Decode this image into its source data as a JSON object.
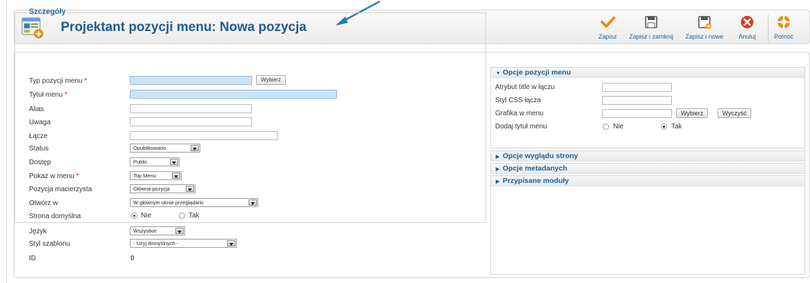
{
  "header": {
    "title": "Projektant pozycji menu: Nowa pozycja",
    "icon": "menu-item-add-icon"
  },
  "toolbar": {
    "buttons": [
      {
        "label": "Zapisz",
        "icon": "checkmark-icon",
        "color": "#f08c00"
      },
      {
        "label": "Zapisz i zamknij",
        "icon": "save-close-icon",
        "color": "#555555"
      },
      {
        "label": "Zapisz i nowe",
        "icon": "save-new-icon",
        "color": "#555555"
      },
      {
        "label": "Anuluj",
        "icon": "cancel-icon",
        "color": "#d63b1f"
      },
      {
        "label": "Pomoc",
        "icon": "help-icon",
        "color": "#f08c00"
      }
    ]
  },
  "details": {
    "legend": "Szczegóły",
    "type": {
      "label": "Typ pozycji menu",
      "button": "Wybierz"
    },
    "title": {
      "label": "Tytuł menu"
    },
    "alias": {
      "label": "Alias"
    },
    "note": {
      "label": "Uwaga"
    },
    "link": {
      "label": "Łącze"
    },
    "status": {
      "label": "Status",
      "value": "Opublikowano"
    },
    "access": {
      "label": "Dostęp",
      "value": "Public"
    },
    "menu": {
      "label": "Pokaż w menu",
      "value": "Top Menu"
    },
    "parent": {
      "label": "Pozycja macierzysta",
      "value": "Główna pozycja"
    },
    "target": {
      "label": "Otwórz w",
      "value": "W głównym oknie przeglądarki"
    },
    "default_page": {
      "label": "Strona domyślna",
      "option_no": "Nie",
      "option_yes": "Tak",
      "selected": "Nie"
    },
    "language": {
      "label": "Język",
      "value": "Wszystkie"
    },
    "template_style": {
      "label": "Styl szablonu",
      "value": "- Użyj domyślnych -"
    },
    "id": {
      "label": "ID",
      "value": "0"
    }
  },
  "link_options": {
    "header": "Opcje pozycji menu",
    "title_attr": {
      "label": "Atrybut title w łączu"
    },
    "css_style": {
      "label": "Styl CSS łącza"
    },
    "image": {
      "label": "Grafika w menu",
      "select_button": "Wybierz",
      "clear_button": "Wyczyść"
    },
    "add_title": {
      "label": "Dodaj tytuł menu",
      "option_no": "Nie",
      "option_yes": "Tak",
      "selected": "Tak"
    }
  },
  "collapsed_panels": [
    {
      "header": "Opcje wyglądu strony"
    },
    {
      "header": "Opcje metadanych"
    },
    {
      "header": "Przypisane moduły"
    }
  ]
}
